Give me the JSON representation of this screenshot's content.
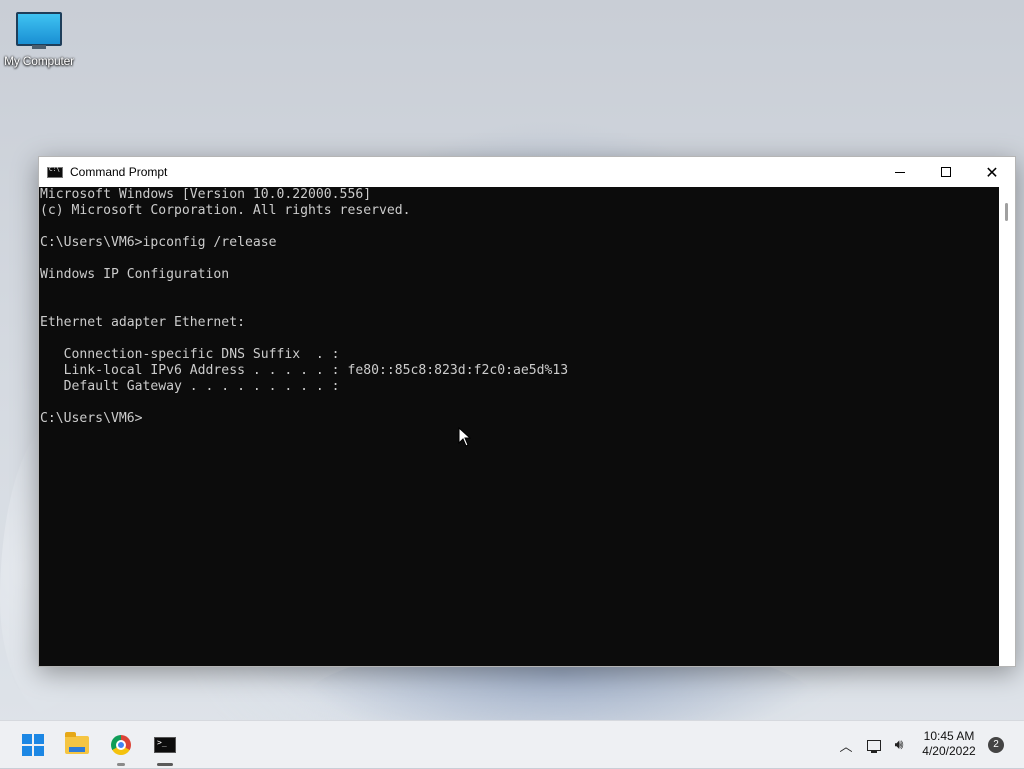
{
  "desktop": {
    "icons": [
      {
        "label": "My Computer",
        "icon": "monitor-icon"
      }
    ]
  },
  "window": {
    "title": "Command Prompt",
    "controls": {
      "minimize": "minimize-icon",
      "maximize": "maximize-icon",
      "close": "close-icon"
    },
    "console_lines": [
      "Microsoft Windows [Version 10.0.22000.556]",
      "(c) Microsoft Corporation. All rights reserved.",
      "",
      "C:\\Users\\VM6>ipconfig /release",
      "",
      "Windows IP Configuration",
      "",
      "",
      "Ethernet adapter Ethernet:",
      "",
      "   Connection-specific DNS Suffix  . :",
      "   Link-local IPv6 Address . . . . . : fe80::85c8:823d:f2c0:ae5d%13",
      "   Default Gateway . . . . . . . . . :",
      "",
      "C:\\Users\\VM6>"
    ]
  },
  "taskbar": {
    "apps": [
      {
        "name": "Start",
        "icon": "windows-start-icon"
      },
      {
        "name": "File Explorer",
        "icon": "folder-icon"
      },
      {
        "name": "Google Chrome",
        "icon": "chrome-icon"
      },
      {
        "name": "Command Prompt",
        "icon": "terminal-icon"
      }
    ],
    "tray": {
      "time": "10:45 AM",
      "date": "4/20/2022",
      "notification_count": "2"
    }
  },
  "colors": {
    "console_bg": "#0c0c0c",
    "console_text": "#cccccc",
    "start_blue": "#1c87e4"
  }
}
